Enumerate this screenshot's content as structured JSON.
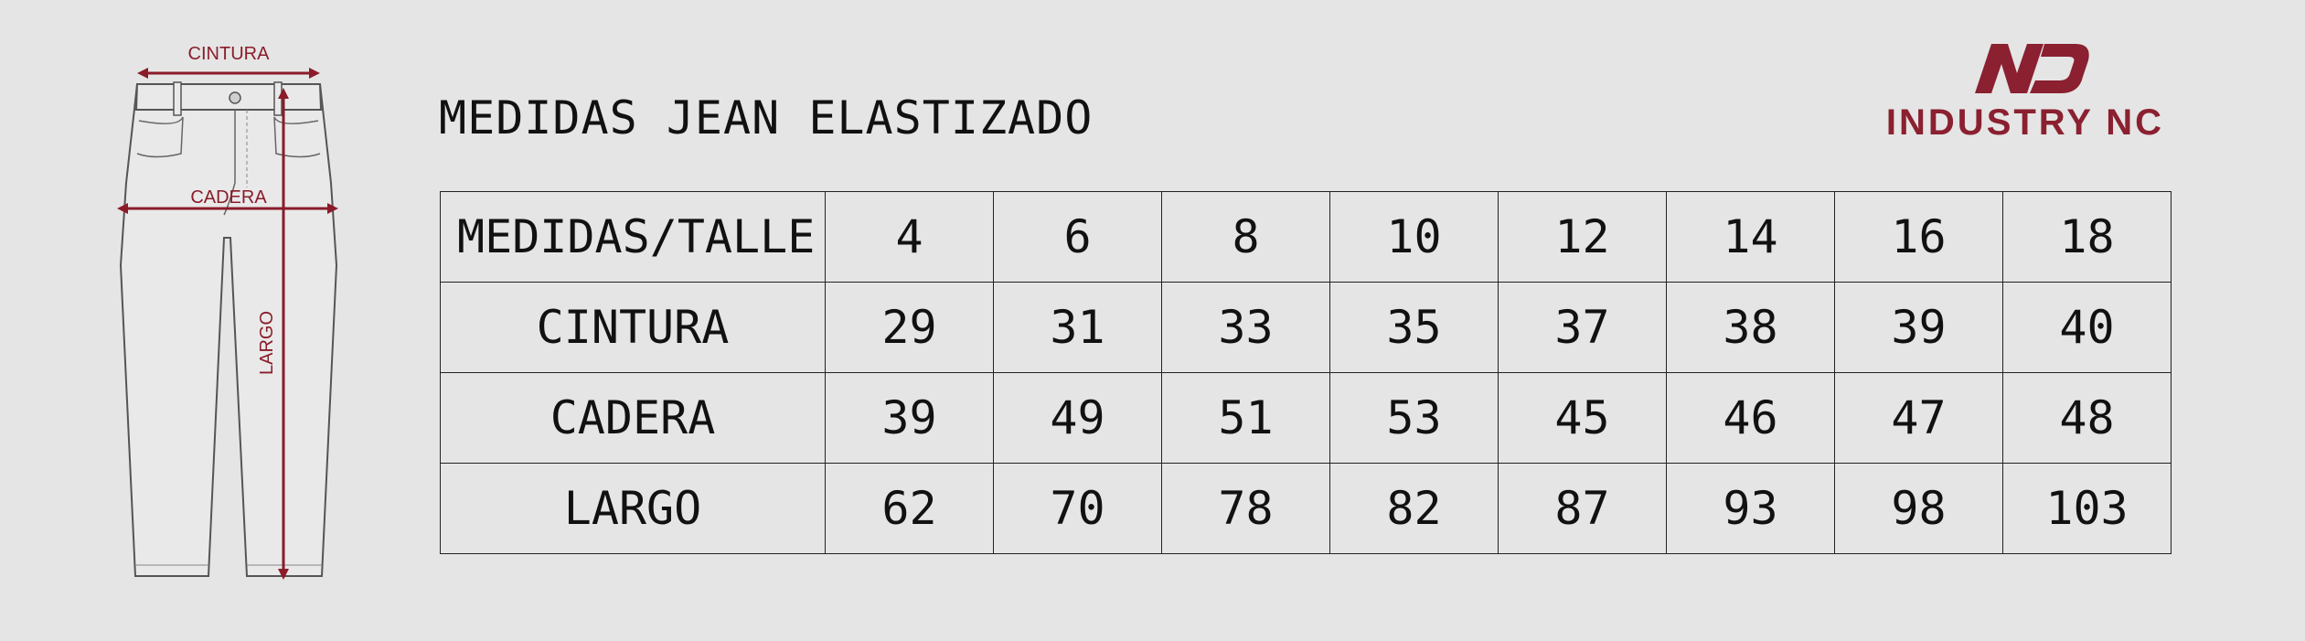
{
  "diagram": {
    "waist_label": "CINTURA",
    "hip_label": "CADERA",
    "length_label": "LARGO"
  },
  "title": "MEDIDAS JEAN ELASTIZADO",
  "brand": {
    "name": "INDUSTRY NC",
    "color": "#8a2030"
  },
  "table": {
    "header_label": "MEDIDAS/TALLE",
    "sizes": [
      "4",
      "6",
      "8",
      "10",
      "12",
      "14",
      "16",
      "18"
    ],
    "rows": [
      {
        "label": "CINTURA",
        "values": [
          "29",
          "31",
          "33",
          "35",
          "37",
          "38",
          "39",
          "40"
        ]
      },
      {
        "label": "CADERA",
        "values": [
          "39",
          "49",
          "51",
          "53",
          "45",
          "46",
          "47",
          "48"
        ]
      },
      {
        "label": "LARGO",
        "values": [
          "62",
          "70",
          "78",
          "82",
          "87",
          "93",
          "98",
          "103"
        ]
      }
    ]
  }
}
